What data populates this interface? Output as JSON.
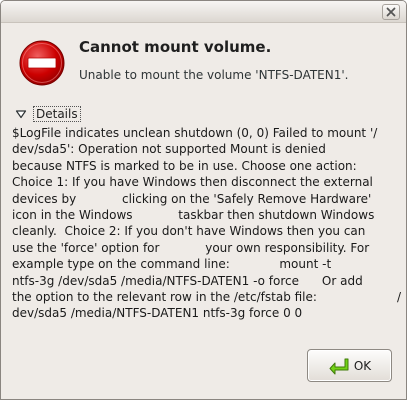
{
  "window": {
    "title": "",
    "close_glyph": "✕"
  },
  "dialog": {
    "heading": "Cannot mount volume.",
    "message": "Unable to mount the volume 'NTFS-DATEN1'.",
    "icon": "stop-icon",
    "details_label": "Details",
    "details_lines": [
      "$LogFile indicates unclean shutdown (0, 0) Failed to mount '/",
      "dev/sda5': Operation not supported Mount is denied",
      "because NTFS is marked to be in use. Choose one action:",
      "Choice 1: If you have Windows then disconnect the external",
      "devices by            clicking on the 'Safely Remove Hardware'",
      "icon in the Windows            taskbar then shutdown Windows",
      "cleanly.  Choice 2: If you don't have Windows then you can",
      "use the 'force' option for            your own responsibility. For",
      "example type on the command line:             mount -t",
      "ntfs-3g /dev/sda5 /media/NTFS-DATEN1 -o force      Or add",
      "the option to the relevant row in the /etc/fstab file:                     /",
      "dev/sda5 /media/NTFS-DATEN1 ntfs-3g force 0 0"
    ],
    "ok_label": "OK"
  },
  "colors": {
    "stop_red": "#cc0000",
    "ok_arrow_green": "#4e9a06",
    "window_bg": "#efebe7"
  }
}
